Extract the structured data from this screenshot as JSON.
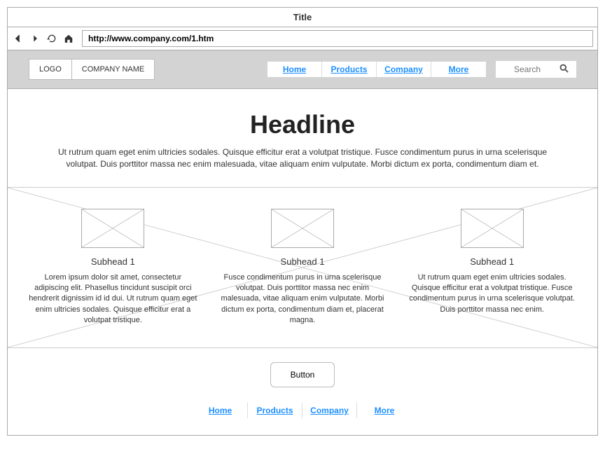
{
  "window": {
    "title": "Title"
  },
  "browser": {
    "url": "http://www.company.com/1.htm"
  },
  "header": {
    "logo": "LOGO",
    "company_name": "COMPANY NAME",
    "nav": [
      "Home",
      "Products",
      "Company",
      "More"
    ],
    "search_placeholder": "Search"
  },
  "hero": {
    "headline": "Headline",
    "body": "Ut rutrum quam eget enim ultricies sodales. Quisque efficitur erat a volutpat tristique. Fusce condimentum purus in urna scelerisque volutpat. Duis porttitor massa nec enim malesuada, vitae aliquam enim vulputate. Morbi dictum ex porta, condimentum diam et."
  },
  "columns": [
    {
      "subhead": "Subhead 1",
      "body": "Lorem ipsum dolor sit amet, consectetur adipiscing elit. Phasellus tincidunt suscipit orci hendrerit dignissim id id dui. Ut rutrum quam eget enim ultricies sodales. Quisque efficitur erat a volutpat tristique."
    },
    {
      "subhead": "Subhead 1",
      "body": "Fusce condimentum purus in urna scelerisque volutpat. Duis porttitor massa nec enim malesuada, vitae aliquam enim vulputate. Morbi dictum ex porta, condimentum diam et, placerat magna."
    },
    {
      "subhead": "Subhead 1",
      "body": "Ut rutrum quam eget enim ultricies sodales. Quisque efficitur erat a volutpat tristique. Fusce condimentum purus in urna scelerisque volutpat. Duis porttitor massa nec enim."
    }
  ],
  "footer": {
    "button": "Button",
    "nav": [
      "Home",
      "Products",
      "Company",
      "More"
    ]
  }
}
